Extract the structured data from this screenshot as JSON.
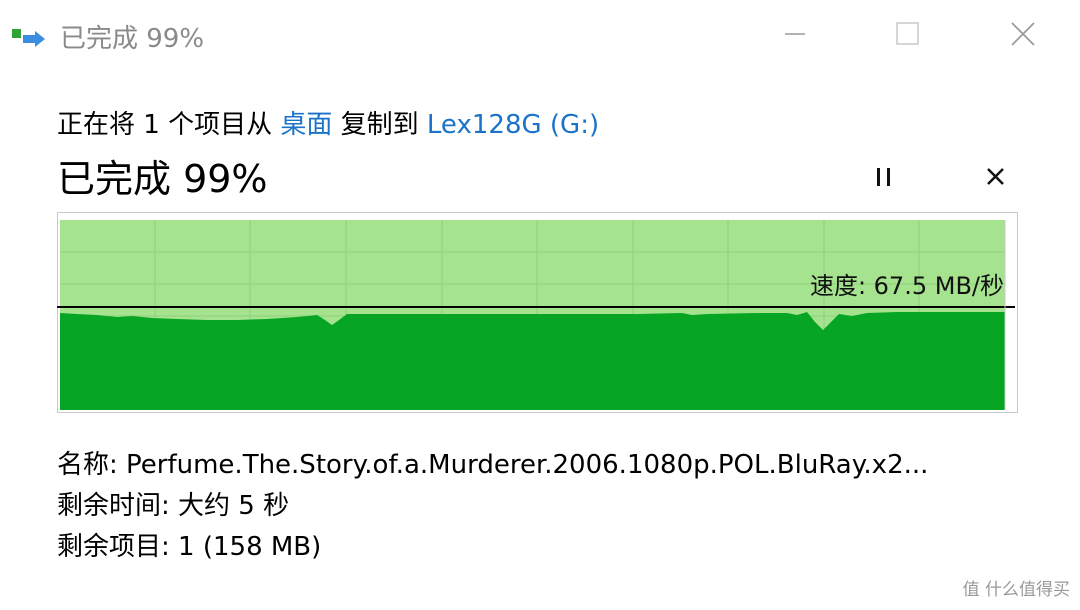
{
  "window": {
    "title": "已完成 99%",
    "icon": "copy-transfer-icon",
    "controls": {
      "minimize": "minimize-icon",
      "maximize": "maximize-icon",
      "close": "close-icon"
    }
  },
  "operation": {
    "prefix": "正在将 1 个项目从",
    "source": "桌面",
    "middle": "复制到",
    "destination": "Lex128G (G:)"
  },
  "progress": {
    "label": "已完成 99%",
    "percent": 99,
    "pause_icon": "pause-icon",
    "cancel_icon": "close-icon"
  },
  "speed": {
    "label": "速度: 67.5 MB/秒",
    "current": 67.5,
    "unit": "MB/秒"
  },
  "details": {
    "name_label": "名称:",
    "name_value": "Perfume.The.Story.of.a.Murderer.2006.1080p.POL.BluRay.x2...",
    "time_label": "剩余时间:",
    "time_value": "大约 5 秒",
    "items_label": "剩余项目:",
    "items_value": "1 (158 MB)"
  },
  "colors": {
    "graph_light": "#a6e38f",
    "graph_dark": "#07a524",
    "graph_grid": "#8ed27a",
    "link": "#1a73c8"
  },
  "watermark": "值 什么值得买"
}
